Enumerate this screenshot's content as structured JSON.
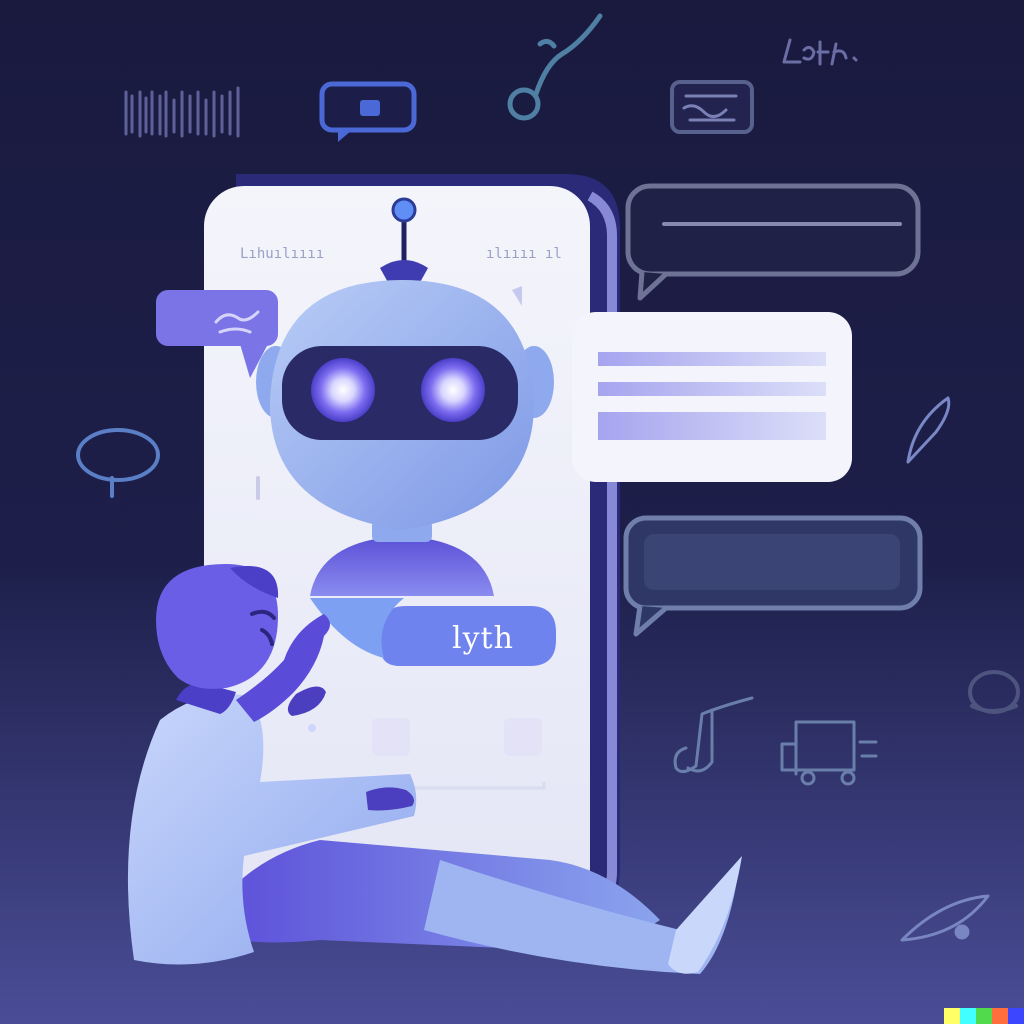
{
  "scene": {
    "type": "illustration",
    "subject": "chatbot-on-smartphone",
    "icons": [
      "barcode-icon",
      "message-icon",
      "music-note-icon",
      "card-icon",
      "scribble-text-icon",
      "speech-circle-icon",
      "pen-icon",
      "note-icon",
      "truck-icon",
      "eye-icon"
    ]
  },
  "phone": {
    "status_left": "Lıhuılıııı",
    "status_right": "ılıııı ıl"
  },
  "chat": {
    "reply_text": "lyth"
  },
  "colors": {
    "background": "#191a3e",
    "accent": "#6f6ee8",
    "robot_light": "#9fb6f0",
    "robot_visor": "#2a2a66",
    "screen": "#f4f5fb"
  }
}
